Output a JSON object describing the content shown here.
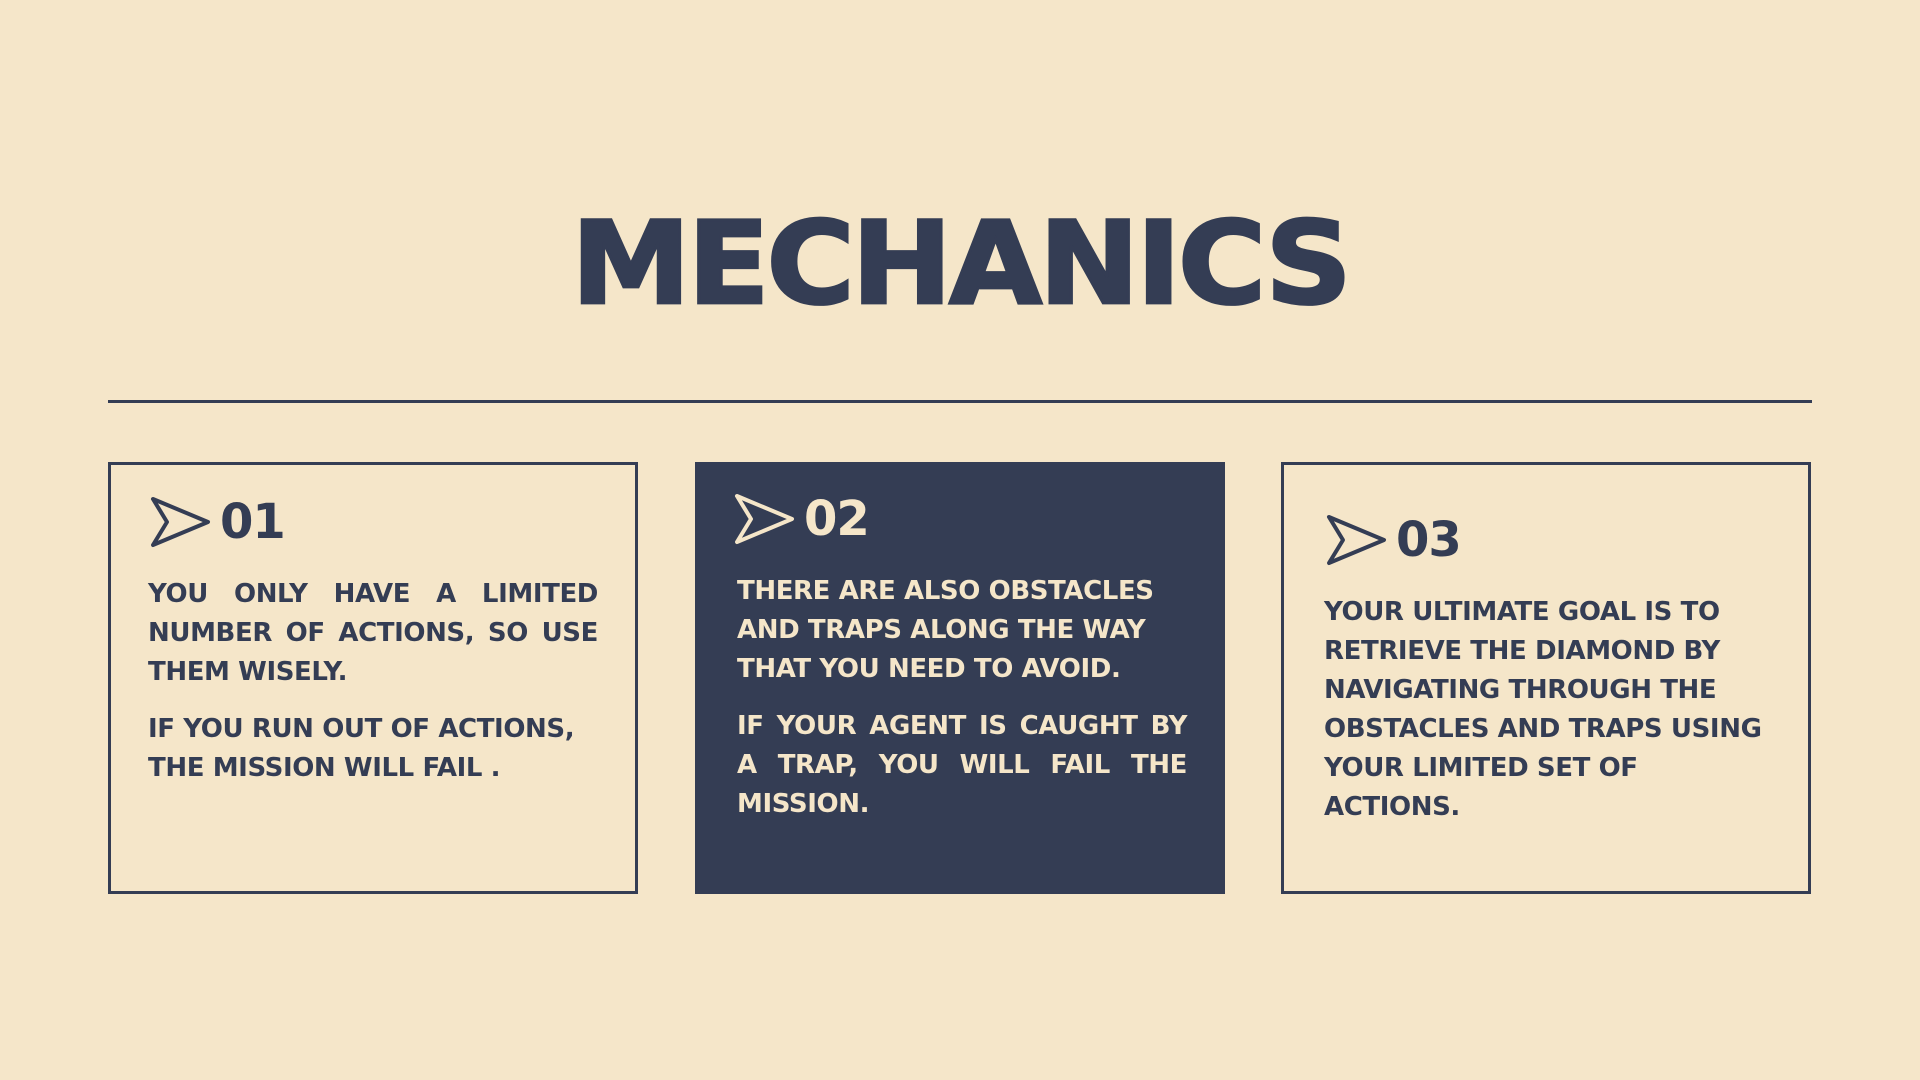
{
  "slide": {
    "title": "MECHANICS"
  },
  "cards": [
    {
      "number": "01",
      "icon": "arrow-pointer-icon",
      "paragraphs": [
        "YOU ONLY HAVE A LIMITED NUMBER OF ACTIONS, SO USE THEM WISELY.",
        "IF YOU RUN OUT OF ACTIONS, THE MISSION WILL FAIL ."
      ]
    },
    {
      "number": "02",
      "icon": "arrow-pointer-icon",
      "paragraphs": [
        "THERE ARE ALSO OBSTACLES AND TRAPS ALONG THE WAY THAT YOU NEED TO AVOID.",
        "IF YOUR AGENT IS CAUGHT BY A TRAP, YOU WILL FAIL THE MISSION."
      ]
    },
    {
      "number": "03",
      "icon": "arrow-pointer-icon",
      "paragraphs": [
        "YOUR ULTIMATE GOAL IS TO RETRIEVE THE DIAMOND BY NAVIGATING THROUGH THE OBSTACLES AND TRAPS USING YOUR LIMITED SET OF ACTIONS."
      ]
    }
  ],
  "colors": {
    "background": "#F5E6C9",
    "navy": "#343D54"
  }
}
